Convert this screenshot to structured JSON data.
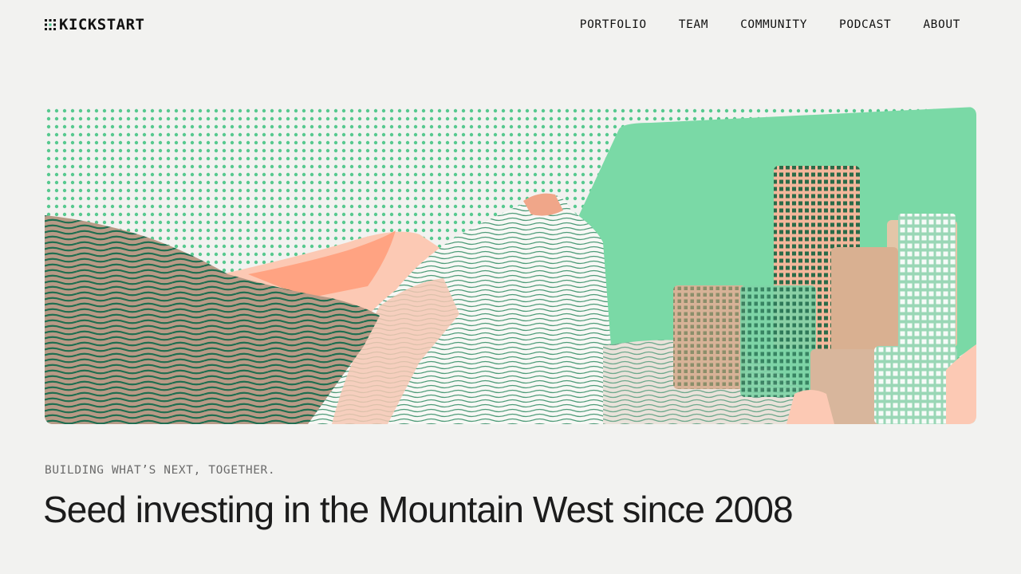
{
  "brand": {
    "name": "KICKSTART",
    "logo_icon": "kickstart-grid-icon",
    "accent": "#3fbf84"
  },
  "nav": {
    "items": [
      {
        "label": "PORTFOLIO"
      },
      {
        "label": "TEAM"
      },
      {
        "label": "COMMUNITY"
      },
      {
        "label": "PODCAST"
      },
      {
        "label": "ABOUT"
      }
    ]
  },
  "hero": {
    "illustration": "mountain-city-collage-illustration",
    "colors": {
      "mint": "#7ad9a6",
      "salmon": "#ffa382",
      "peach": "#fcc9b4",
      "dark_green": "#1f6e50",
      "dot": "#57c98f"
    }
  },
  "intro": {
    "tagline": "BUILDING WHAT’S NEXT, TOGETHER.",
    "headline": "Seed investing in the Mountain West since 2008"
  }
}
